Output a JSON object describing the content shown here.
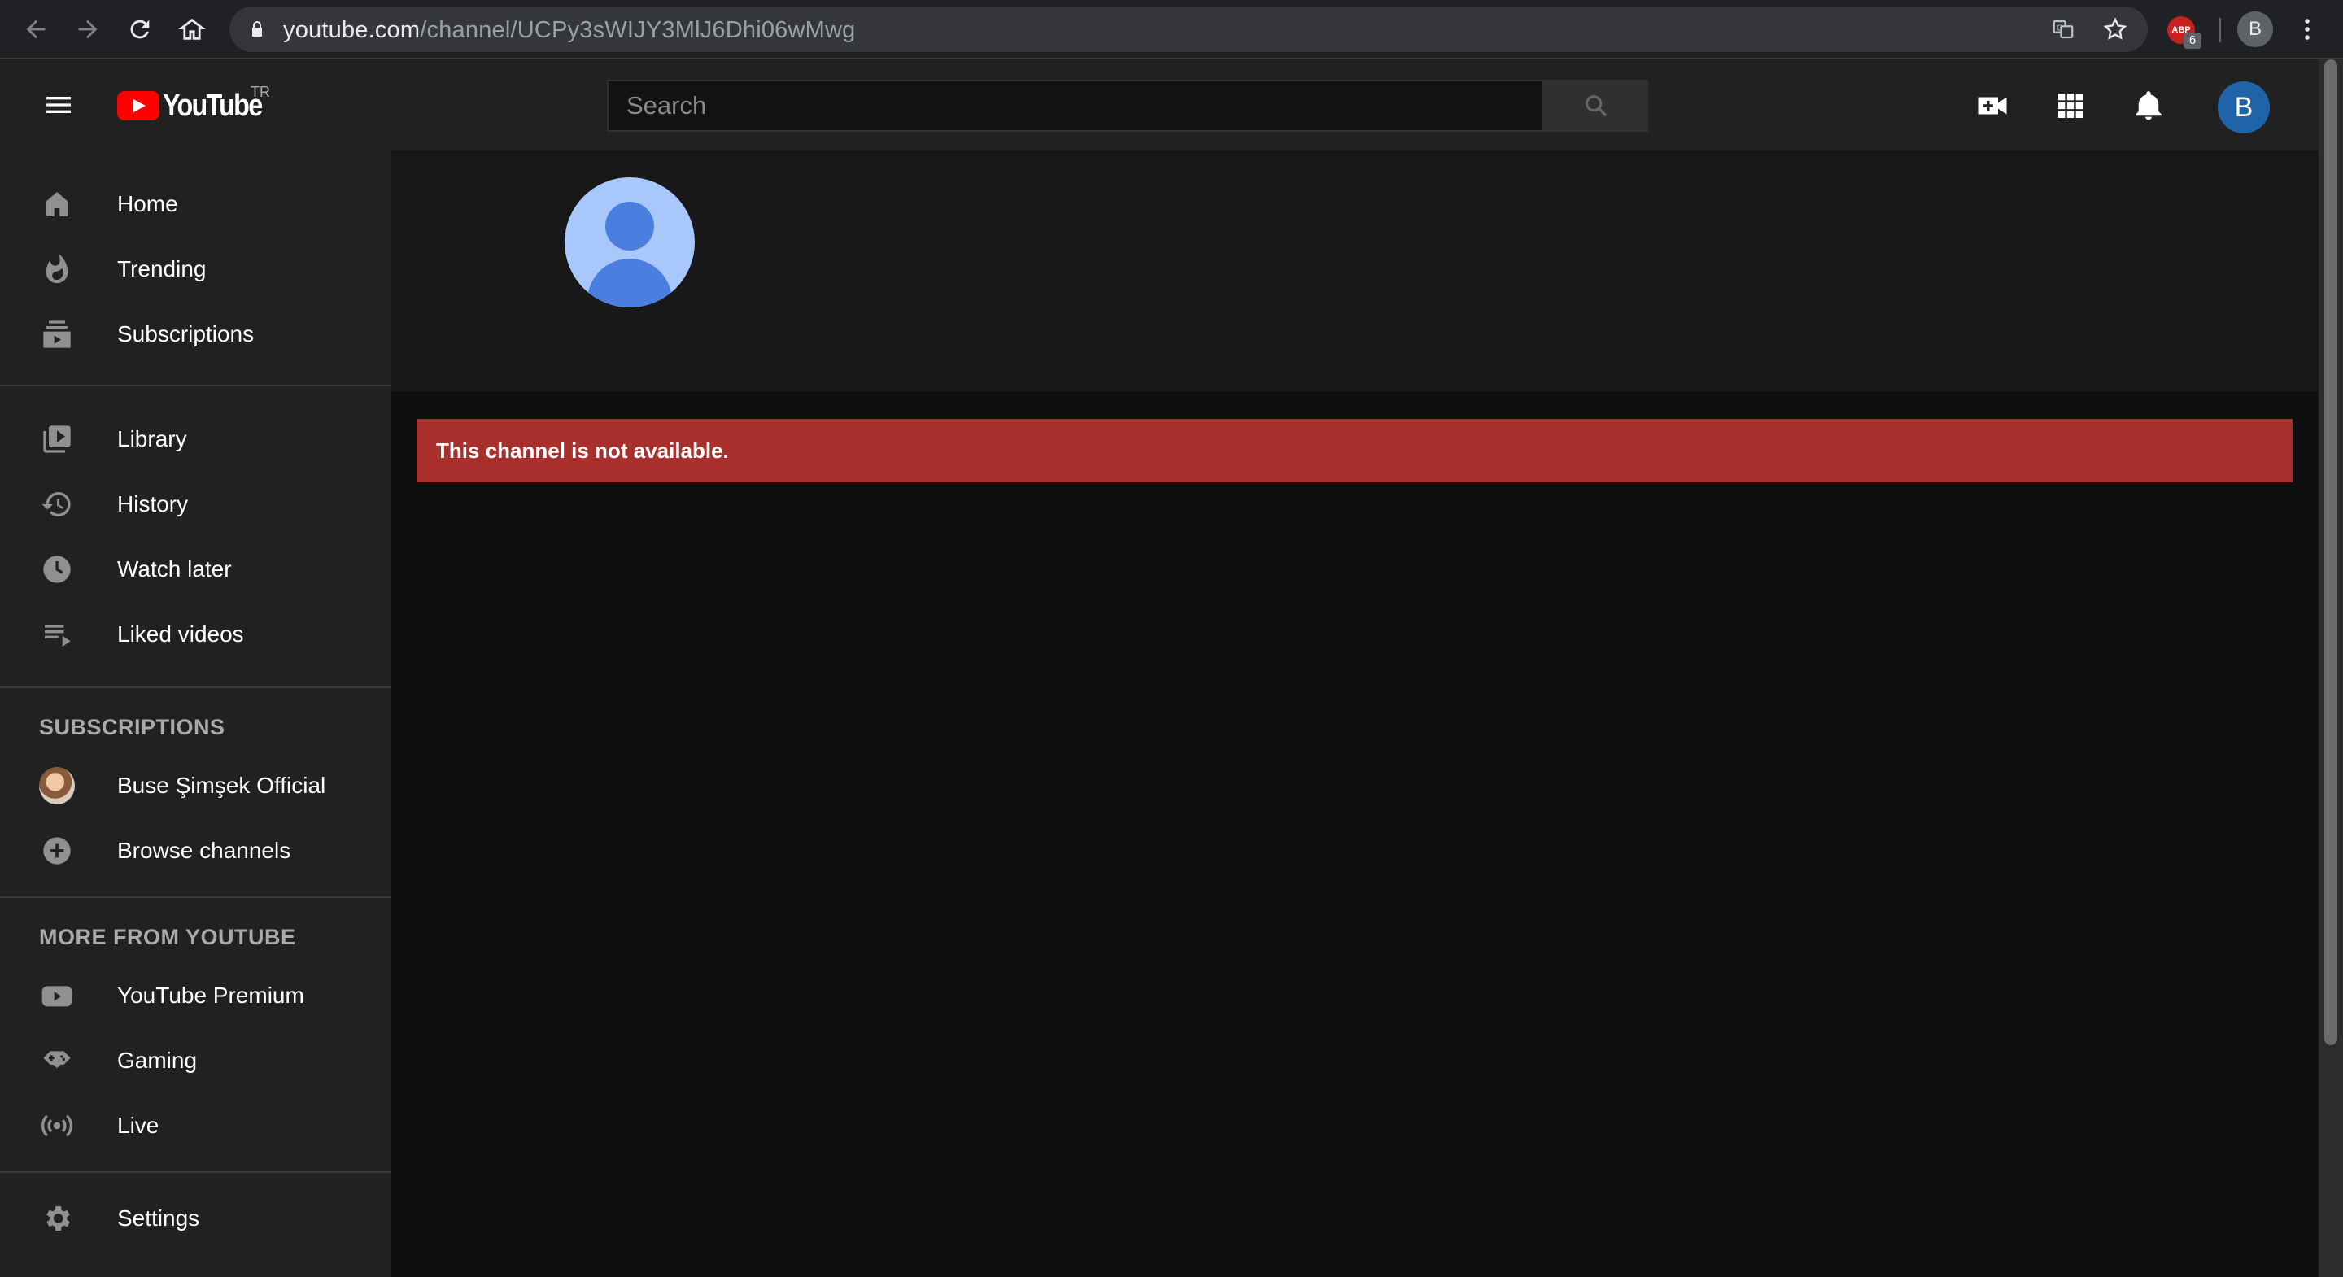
{
  "browser": {
    "url_host": "youtube.com",
    "url_path": "/channel/UCPy3sWIJY3MlJ6Dhi06wMwg",
    "extension_badge": "6",
    "extension_label": "ABP",
    "profile_initial": "B"
  },
  "masthead": {
    "logo_text": "YouTube",
    "region_code": "TR",
    "search_placeholder": "Search",
    "avatar_initial": "B"
  },
  "sidebar": {
    "main": [
      {
        "label": "Home",
        "icon": "home-icon"
      },
      {
        "label": "Trending",
        "icon": "fire-icon"
      },
      {
        "label": "Subscriptions",
        "icon": "subscriptions-icon"
      }
    ],
    "library": [
      {
        "label": "Library",
        "icon": "library-icon"
      },
      {
        "label": "History",
        "icon": "history-icon"
      },
      {
        "label": "Watch later",
        "icon": "clock-icon"
      },
      {
        "label": "Liked videos",
        "icon": "playlist-icon"
      }
    ],
    "subscriptions_heading": "SUBSCRIPTIONS",
    "subscriptions": [
      {
        "label": "Buse Şimşek Official",
        "icon": "channel-avatar"
      },
      {
        "label": "Browse channels",
        "icon": "add-circle-icon"
      }
    ],
    "more_heading": "MORE FROM YOUTUBE",
    "more": [
      {
        "label": "YouTube Premium",
        "icon": "youtube-icon"
      },
      {
        "label": "Gaming",
        "icon": "gamepad-icon"
      },
      {
        "label": "Live",
        "icon": "live-icon"
      }
    ],
    "settings": {
      "label": "Settings",
      "icon": "gear-icon"
    }
  },
  "main": {
    "alert_text": "This channel is not available."
  },
  "colors": {
    "alert": "#a82f2b",
    "youtube_red": "#ff0000",
    "avatar_blue": "#1f63a8"
  }
}
